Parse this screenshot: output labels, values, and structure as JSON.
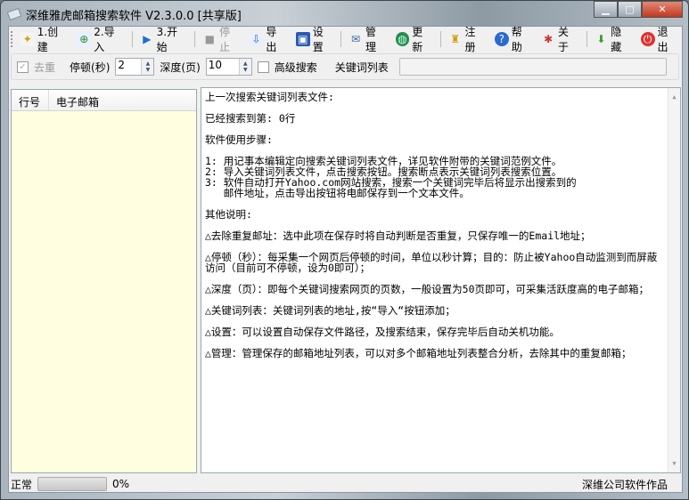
{
  "window": {
    "title": "深维雅虎邮箱搜索软件 V2.3.0.0 [共享版]"
  },
  "toolbar": [
    {
      "label": "1.创建",
      "icon": "new-file-icon"
    },
    {
      "label": "2.导入",
      "icon": "import-icon"
    },
    {
      "label": "3.开始",
      "icon": "play-icon"
    },
    {
      "label": "停止",
      "icon": "stop-icon",
      "disabled": true
    },
    {
      "label": "导出",
      "icon": "export-icon"
    },
    {
      "label": "设置",
      "icon": "save-settings-icon"
    },
    {
      "label": "管理",
      "icon": "mail-manage-icon"
    },
    {
      "label": "更新",
      "icon": "globe-icon"
    },
    {
      "label": "注册",
      "icon": "register-icon"
    },
    {
      "label": "帮助",
      "icon": "help-icon"
    },
    {
      "label": "关于",
      "icon": "about-icon"
    },
    {
      "label": "隐藏",
      "icon": "hide-icon"
    },
    {
      "label": "退出",
      "icon": "power-icon"
    }
  ],
  "options": {
    "dedup_label": "去重",
    "dedup_checked": true,
    "pause_label": "停顿(秒)",
    "pause_value": "2",
    "depth_label": "深度(页)",
    "depth_value": "10",
    "advanced_label": "高级搜索",
    "advanced_checked": false,
    "keyword_list_label": "关键词列表",
    "keyword_list_value": ""
  },
  "list": {
    "columns": [
      "行号",
      "电子邮箱"
    ]
  },
  "info_text": [
    "上一次搜索关键词列表文件:\n",
    "已经搜索到第: 0行",
    "软件使用步骤:",
    "1: 用记事本编辑定向搜索关键词列表文件，详见软件附带的关键词范例文件。\n2: 导入关键词列表文件，点击搜索按钮。搜索断点表示关键词列表搜索位置。\n3: 软件自动打开Yahoo.com网站搜索，搜索一个关键词完毕后将显示出搜索到的\n   邮件地址，点击导出按钮将电邮保存到一个文本文件。",
    "其他说明:",
    "△去除重复邮址：选中此项在保存时将自动判断是否重复，只保存唯一的Email地址；",
    "△停顿（秒）：每采集一个网页后停顿的时间，单位以秒计算；目的：防止被Yahoo自动监测到而屏蔽访问（目前可不停顿，设为0即可）；",
    "△深度（页）：即每个关键词搜索网页的页数，一般设置为50页即可，可采集活跃度高的电子邮箱；",
    "△关键词列表：关键词列表的地址,按“导入“按钮添加；",
    "△设置：可以设置自动保存文件路径，及搜索结束，保存完毕后自动关机功能。",
    "△管理：管理保存的邮箱地址列表，可以对多个邮箱地址列表整合分析，去除其中的重复邮箱；"
  ],
  "status": {
    "state": "正常",
    "progress_text": "0%",
    "progress": 0,
    "credit": "深维公司软件作品"
  }
}
